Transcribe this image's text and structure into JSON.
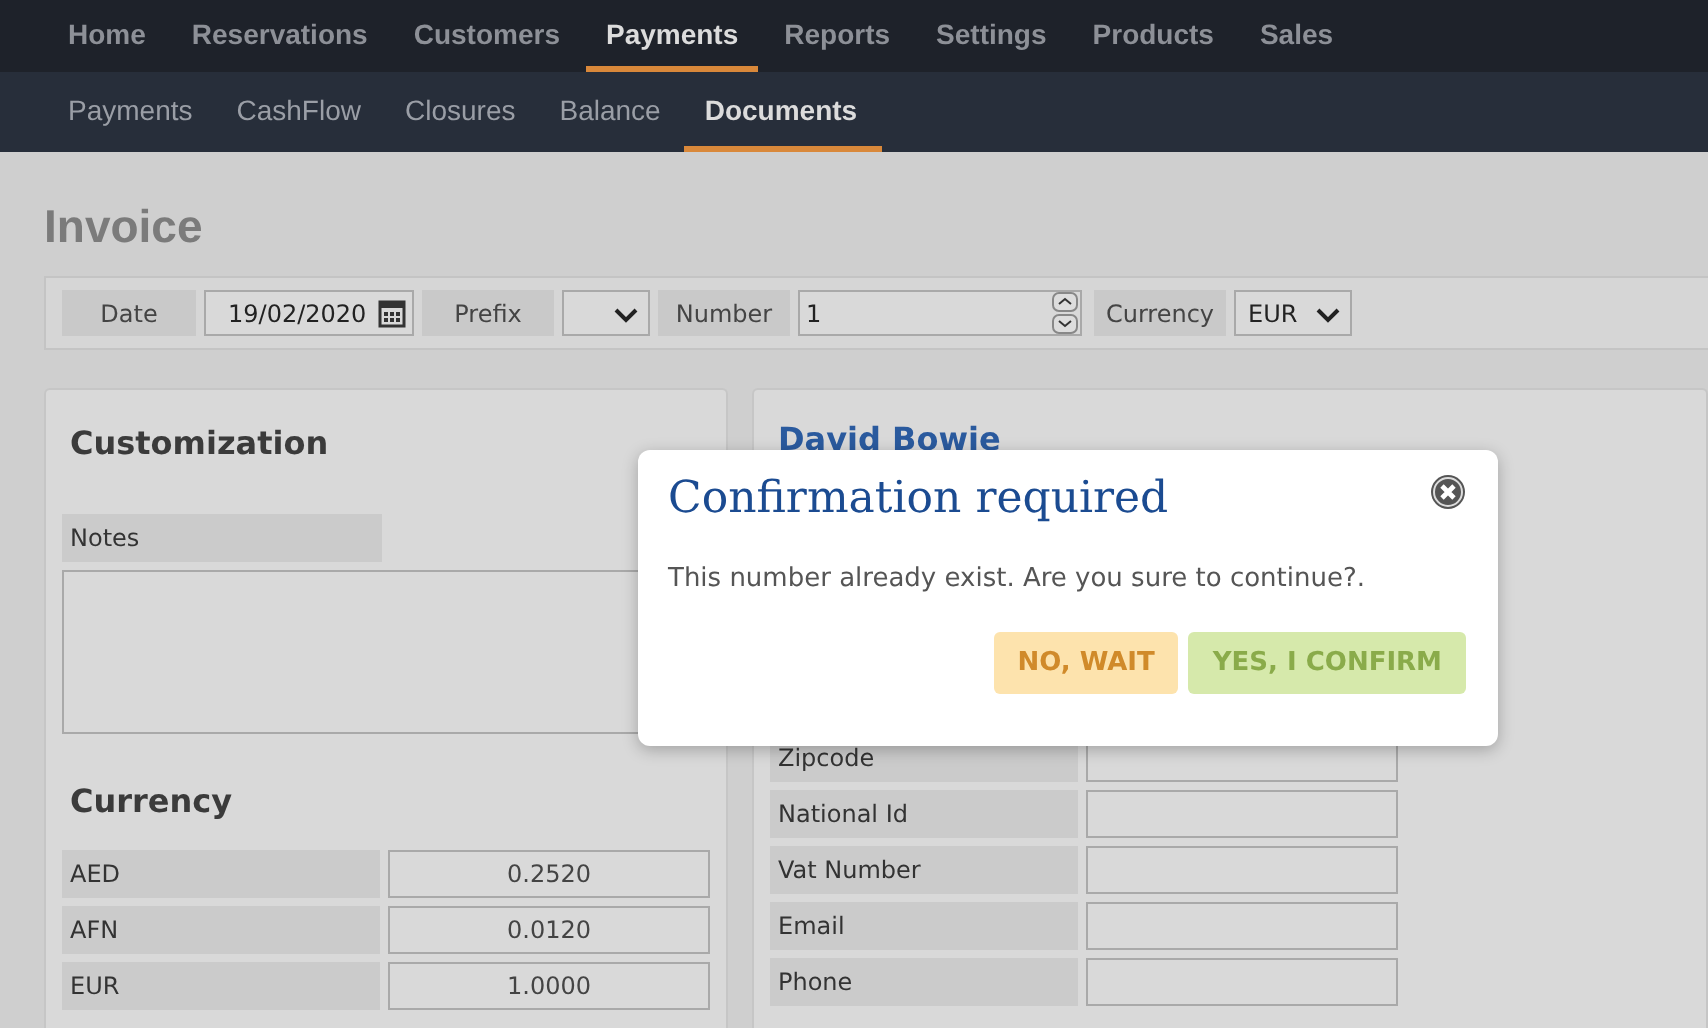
{
  "main_nav": [
    {
      "label": "Home",
      "selected": false
    },
    {
      "label": "Reservations",
      "selected": false
    },
    {
      "label": "Customers",
      "selected": false
    },
    {
      "label": "Payments",
      "selected": true
    },
    {
      "label": "Reports",
      "selected": false
    },
    {
      "label": "Settings",
      "selected": false
    },
    {
      "label": "Products",
      "selected": false
    },
    {
      "label": "Sales",
      "selected": false
    }
  ],
  "sub_nav": [
    {
      "label": "Payments",
      "selected": false
    },
    {
      "label": "CashFlow",
      "selected": false
    },
    {
      "label": "Closures",
      "selected": false
    },
    {
      "label": "Balance",
      "selected": false
    },
    {
      "label": "Documents",
      "selected": true
    }
  ],
  "page_title": "Invoice",
  "toolbar": [
    {
      "kind": "date",
      "label": "Date",
      "value": "19/02/2020"
    },
    {
      "kind": "select",
      "label": "Prefix"
    },
    {
      "kind": "number",
      "label": "Number",
      "value": "1"
    },
    {
      "kind": "select",
      "label": "Currency",
      "value": "EUR"
    }
  ],
  "customization": {
    "title": "Customization",
    "notes_label": "Notes"
  },
  "currency": {
    "title": "Currency",
    "rows": [
      {
        "code": "AED",
        "rate": "0.2520"
      },
      {
        "code": "AFN",
        "rate": "0.0120"
      },
      {
        "code": "EUR",
        "rate": "1.0000"
      }
    ]
  },
  "customer": {
    "name": "David Bowie",
    "fields": [
      {
        "label": "Zipcode"
      },
      {
        "label": "National Id"
      },
      {
        "label": "Vat Number"
      },
      {
        "label": "Email"
      },
      {
        "label": "Phone"
      }
    ]
  },
  "dialog": {
    "title": "Confirmation required",
    "message": "This number already exist. Are you sure to continue?.",
    "buttons": [
      {
        "kind": "cancel",
        "label": "NO, WAIT"
      },
      {
        "kind": "confirm",
        "label": "YES, I CONFIRM"
      }
    ]
  }
}
